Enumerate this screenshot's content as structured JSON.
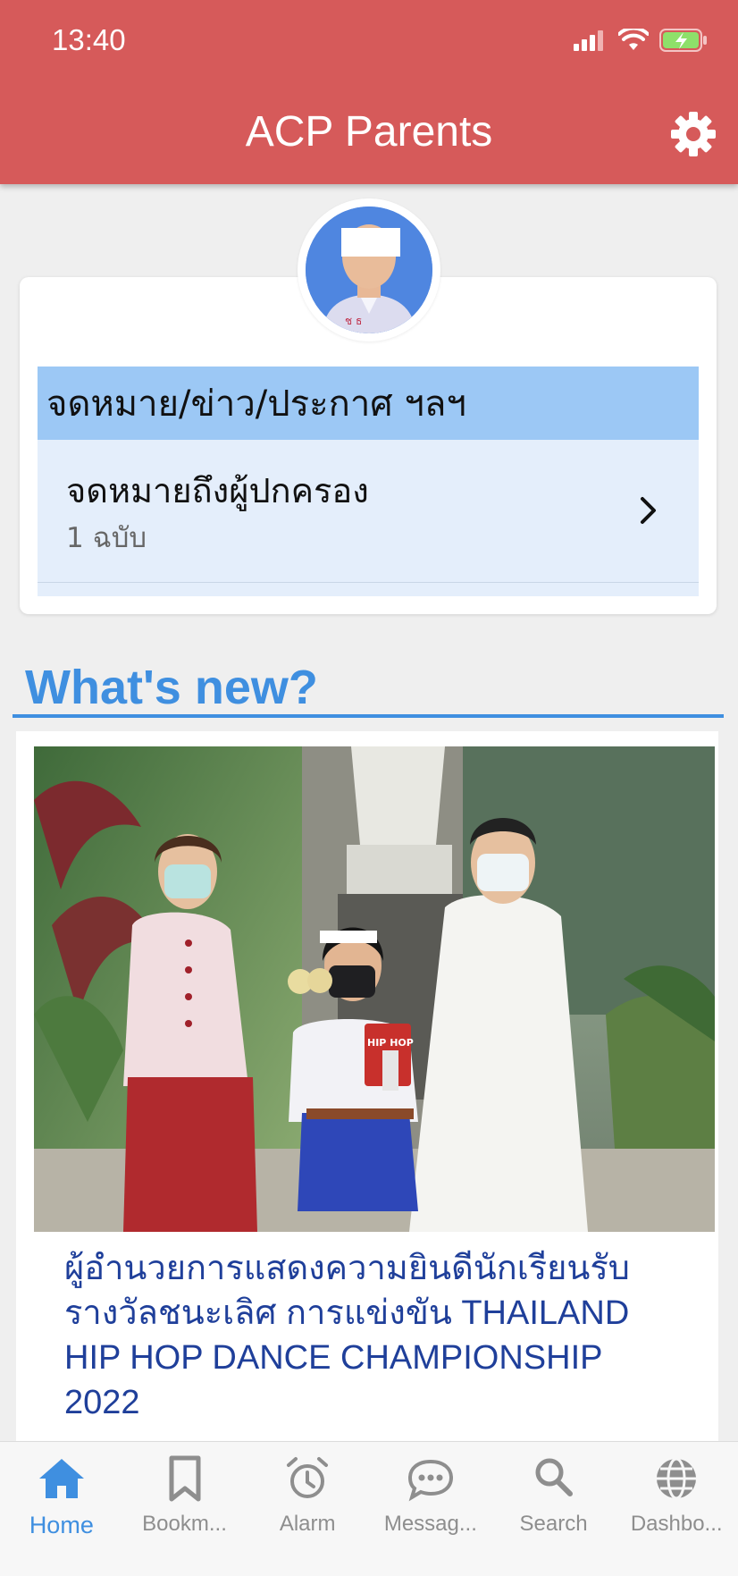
{
  "status_bar": {
    "time": "13:40"
  },
  "header": {
    "title": "ACP Parents",
    "settings_icon": "gear-icon"
  },
  "profile": {
    "avatar_icon": "student-avatar"
  },
  "notices": {
    "section_title": "จดหมาย/ข่าว/ประกาศ ฯลฯ",
    "items": [
      {
        "title": "จดหมายถึงผู้ปกครอง",
        "count": "1 ฉบับ"
      }
    ]
  },
  "whats_new": {
    "heading": "What's new?",
    "news": [
      {
        "title": "ผู้อำนวยการแสดงความยินดีนักเรียนรับรางวัลชนะเลิศ การแข่งขัน THAILAND HIP HOP DANCE CHAMPIONSHIP 2022"
      }
    ]
  },
  "bottom_nav": {
    "items": [
      {
        "label": "Home",
        "icon": "home-icon",
        "active": true
      },
      {
        "label": "Bookm...",
        "icon": "bookmark-icon"
      },
      {
        "label": "Alarm",
        "icon": "alarm-icon"
      },
      {
        "label": "Messag...",
        "icon": "message-icon"
      },
      {
        "label": "Search",
        "icon": "search-icon"
      },
      {
        "label": "Dashbo...",
        "icon": "globe-icon"
      }
    ]
  },
  "colors": {
    "header": "#d65a5a",
    "accent": "#3f8fe0",
    "notice_header": "#9cc8f5",
    "notice_row": "#e4eefb",
    "news_title": "#1f3f9a"
  }
}
